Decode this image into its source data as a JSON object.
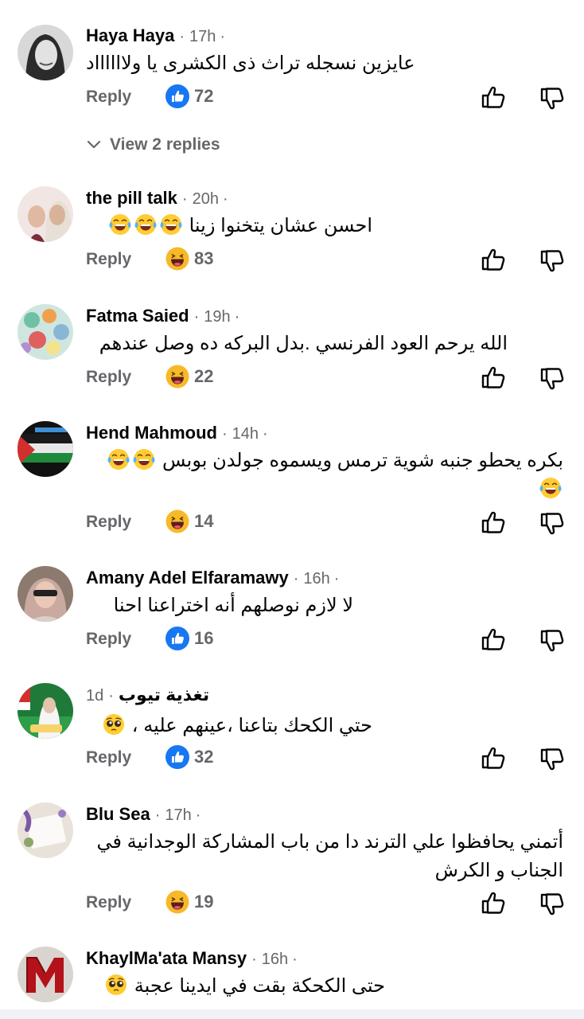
{
  "view_replies_label": "View 2 replies",
  "reply_label": "Reply",
  "comments": [
    {
      "name": "Haya Haya",
      "time": "17h",
      "text": "عايزين نسجله تراث ذى الكشرى يا ولااااااد",
      "reaction": "like",
      "count": "72"
    },
    {
      "name": "the pill talk",
      "time": "20h",
      "text": "احسن عشان يتخنوا زينا",
      "reaction": "haha",
      "count": "83"
    },
    {
      "name": "Fatma Saied",
      "time": "19h",
      "text": "الله يرحم العود الفرنسي .بدل البركه ده وصل عندهم",
      "reaction": "haha",
      "count": "22"
    },
    {
      "name": "Hend Mahmoud",
      "time": "14h",
      "text": "بكره يحطو جنبه شوية ترمس ويسموه جولدن بوبس",
      "reaction": "haha",
      "count": "14"
    },
    {
      "name": "Amany Adel Elfaramawy",
      "time": "16h",
      "text": "لا لازم نوصلهم أنه اختراعنا احنا",
      "reaction": "like",
      "count": "16"
    },
    {
      "name": "تغذية تيوب",
      "time": "1d",
      "text": "حتي الكحك بتاعنا ،عينهم عليه ،",
      "reaction": "like",
      "count": "32"
    },
    {
      "name": "Blu Sea",
      "time": "17h",
      "text": "أتمني يحافظوا علي الترند دا من باب المشاركة الوجدانية في الجناب و الكرش",
      "reaction": "haha",
      "count": "19"
    },
    {
      "name": "KhaylMa'ata Mansy",
      "time": "16h",
      "text": "حتى الكحكة بقت في ايدينا عجبة"
    }
  ],
  "colors": {
    "like_blue": "#1877f2",
    "secondary_text": "#65676b",
    "haha_yellow": "#f7b928"
  },
  "icons": [
    "thumbs-up-outline-icon",
    "thumbs-down-outline-icon",
    "like-reaction-icon",
    "haha-reaction-icon",
    "tears-of-joy-emoji",
    "pleading-face-emoji",
    "chevron-down-icon"
  ]
}
